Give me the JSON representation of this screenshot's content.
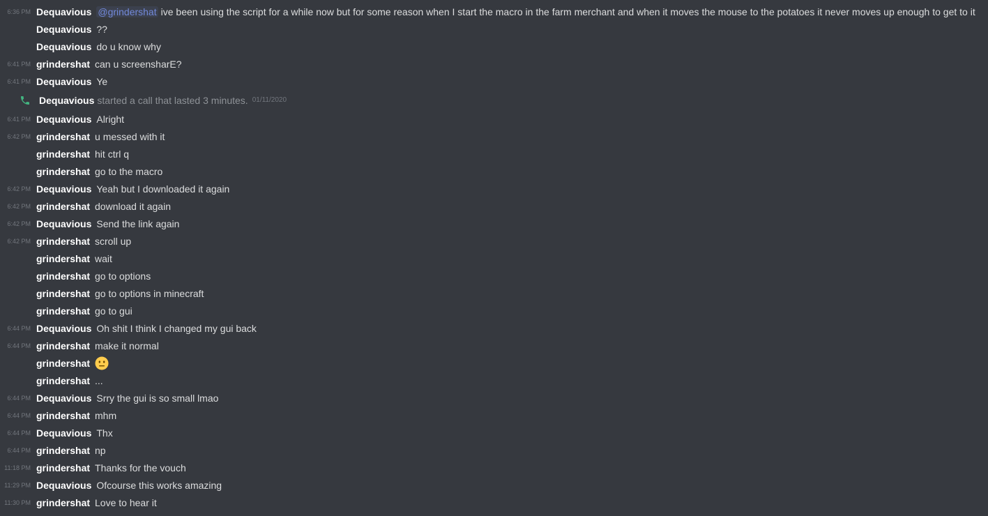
{
  "mention": "@grindershat",
  "messages": [
    {
      "time": "6:36 PM",
      "author": "Dequavious",
      "mention": true,
      "text": "ive been using the script for a while now but for some reason when I start the macro in the farm merchant and when it moves the mouse to the potatoes it never moves up enough to get to it"
    },
    {
      "time": "",
      "author": "Dequavious",
      "text": "??"
    },
    {
      "time": "",
      "author": "Dequavious",
      "text": "do u know why"
    },
    {
      "time": "6:41 PM",
      "author": "grindershat",
      "text": "can u screensharE?"
    },
    {
      "time": "6:41 PM",
      "author": "Dequavious",
      "text": "Ye"
    },
    {
      "type": "call",
      "author": "Dequavious",
      "text": "started a call that lasted 3 minutes.",
      "date": "01/11/2020"
    },
    {
      "time": "6:41 PM",
      "author": "Dequavious",
      "text": "Alright"
    },
    {
      "time": "6:42 PM",
      "author": "grindershat",
      "text": "u messed with it"
    },
    {
      "time": "",
      "author": "grindershat",
      "text": "hit ctrl q"
    },
    {
      "time": "",
      "author": "grindershat",
      "text": "go to the macro"
    },
    {
      "time": "6:42 PM",
      "author": "Dequavious",
      "text": "Yeah but I downloaded it again"
    },
    {
      "time": "6:42 PM",
      "author": "grindershat",
      "text": "download it again"
    },
    {
      "time": "6:42 PM",
      "author": "Dequavious",
      "text": "Send the link again"
    },
    {
      "time": "6:42 PM",
      "author": "grindershat",
      "text": "scroll up"
    },
    {
      "time": "",
      "author": "grindershat",
      "text": "wait"
    },
    {
      "time": "",
      "author": "grindershat",
      "text": "go to options"
    },
    {
      "time": "",
      "author": "grindershat",
      "text": "go to options in minecraft"
    },
    {
      "time": "",
      "author": "grindershat",
      "text": "go to gui"
    },
    {
      "time": "6:44 PM",
      "author": "Dequavious",
      "text": "Oh shit I think I changed my gui back"
    },
    {
      "time": "6:44 PM",
      "author": "grindershat",
      "text": "make it normal"
    },
    {
      "time": "",
      "author": "grindershat",
      "emoji": "neutral-face-emoji",
      "text": ""
    },
    {
      "time": "",
      "author": "grindershat",
      "text": "..."
    },
    {
      "time": "6:44 PM",
      "author": "Dequavious",
      "text": "Srry the gui is so small lmao"
    },
    {
      "time": "6:44 PM",
      "author": "grindershat",
      "text": "mhm"
    },
    {
      "time": "6:44 PM",
      "author": "Dequavious",
      "text": "Thx"
    },
    {
      "time": "6:44 PM",
      "author": "grindershat",
      "text": "np"
    },
    {
      "time": "11:18 PM",
      "author": "grindershat",
      "text": "Thanks for the vouch"
    },
    {
      "time": "11:29 PM",
      "author": "Dequavious",
      "text": "Ofcourse this works amazing"
    },
    {
      "time": "11:30 PM",
      "author": "grindershat",
      "text": "Love to hear it"
    }
  ],
  "colors": {
    "background": "#36393f",
    "author": "#ffffff",
    "text": "#dcddde",
    "timestamp": "#72767d",
    "mention": "#7289da",
    "call_icon": "#43b581"
  }
}
